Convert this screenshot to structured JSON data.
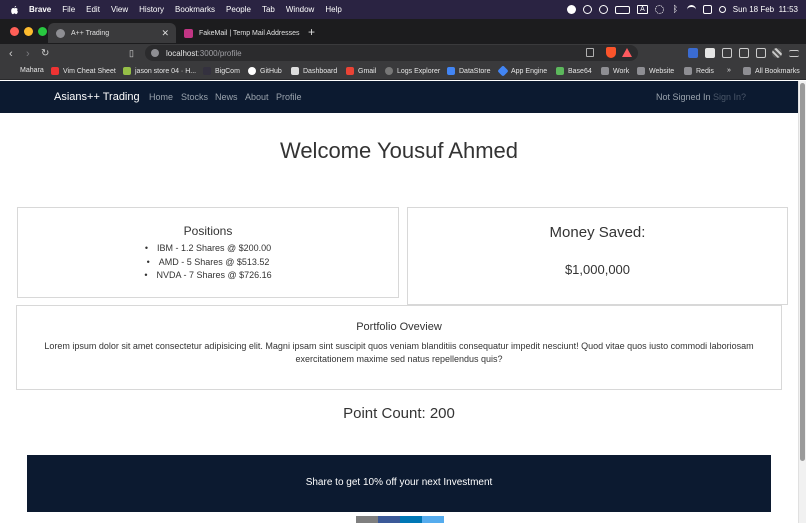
{
  "menubar": {
    "items": [
      "Brave",
      "File",
      "Edit",
      "View",
      "History",
      "Bookmarks",
      "People",
      "Tab",
      "Window",
      "Help"
    ],
    "clock": "Sun 18 Feb  11:53",
    "keyboard_letter": "A"
  },
  "tabs": [
    {
      "title": "A++ Trading",
      "active": true
    },
    {
      "title": "FakeMail | Temp Mail Addresses",
      "active": false
    }
  ],
  "address": {
    "host": "localhost",
    "path": ":3000/profile"
  },
  "bookmarks": [
    "Mahara",
    "Vim Cheat Sheet",
    "jason store 04 · H...",
    "BigCom",
    "GitHub",
    "Dashboard",
    "Gmail",
    "Logs Explorer",
    "DataStore",
    "App Engine",
    "Base64",
    "Work",
    "Website",
    "Redis",
    "»",
    "All Bookmarks"
  ],
  "site": {
    "brand": "Asians++ Trading",
    "nav": [
      "Home",
      "Stocks",
      "News",
      "About",
      "Profile"
    ],
    "status": "Not Signed In",
    "signin": "Sign In?"
  },
  "profile": {
    "welcome": "Welcome Yousuf Ahmed",
    "positions_title": "Positions",
    "positions": [
      "IBM - 1.2 Shares @ $200.00",
      "AMD - 5 Shares @ $513.52",
      "NVDA - 7 Shares @ $726.16"
    ],
    "money_title": "Money Saved:",
    "money_value": "$1,000,000",
    "overview_title": "Portfolio Oveview",
    "overview_text": "Lorem ipsum dolor sit amet consectetur adipisicing elit. Magni ipsam sint suscipit quos veniam blanditiis consequatur impedit nesciunt! Quod vitae quos iusto commodi laboriosam exercitationem maxime sed natus repellendus quis?",
    "point_count": "Point Count: 200",
    "share_banner": "Share to get 10% off your next Investment"
  },
  "colors": {
    "navbar": "#0c1a30",
    "menubar": "#2a2342",
    "browser_chrome": "#3a3a3c"
  }
}
